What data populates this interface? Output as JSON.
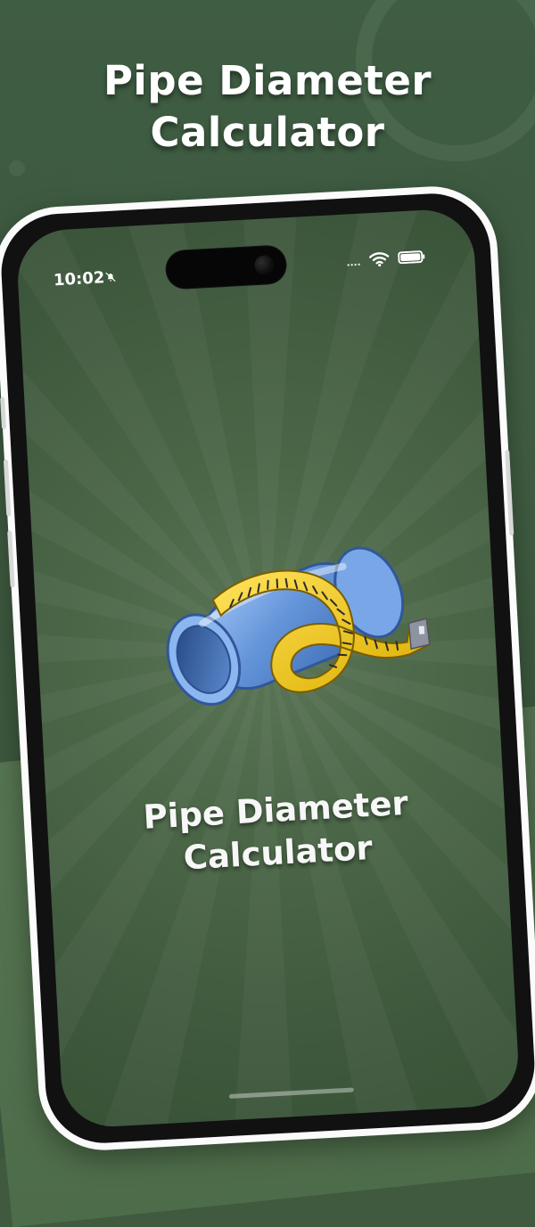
{
  "header": {
    "title_line1": "Pipe Diameter",
    "title_line2": "Calculator"
  },
  "phone": {
    "status_time": "10:02",
    "app_title_line1": "Pipe Diameter",
    "app_title_line2": "Calculator"
  },
  "icons": {
    "notification": "bell-slash-icon",
    "signal": "signal-icon",
    "wifi": "wifi-icon",
    "battery": "battery-icon",
    "app_art": "pipe-measuring-tape-icon"
  },
  "colors": {
    "background": "#3f5a3e",
    "screen": "#4b6647",
    "accent_tape": "#f2cc22",
    "pipe": "#5f8fd4"
  }
}
